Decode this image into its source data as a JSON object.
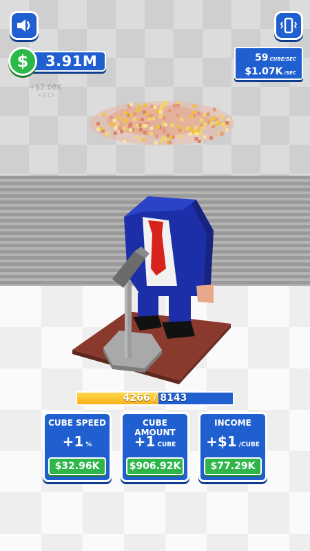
{
  "hud": {
    "money": "3.91M",
    "floating_gain": "+$2.08K",
    "floating_gain_small": "+$13"
  },
  "rates": {
    "cubes_value": "59",
    "cubes_unit": "CUBE/SEC",
    "money_value": "$1.07K",
    "money_unit": "/SEC"
  },
  "progress": {
    "current": 4266,
    "total": 8143,
    "label": "4266 / 8143",
    "fraction": 0.524
  },
  "upgrades": [
    {
      "title": "CUBE SPEED",
      "amount": "+1",
      "unit": "%",
      "price": "$32.96K"
    },
    {
      "title": "CUBE AMOUNT",
      "amount": "+1",
      "unit": "CUBE",
      "price": "$906.92K"
    },
    {
      "title": "INCOME",
      "amount": "+$1",
      "unit": "/CUBE",
      "price": "$77.29K"
    }
  ],
  "icons": {
    "sound": "speaker-icon",
    "vibration": "vibration-icon",
    "currency": "dollar-icon"
  },
  "colors": {
    "panel_blue": "#1f5fd0",
    "buy_green": "#2fb64a",
    "progress_yellow": "#f7b21a",
    "suit_blue": "#1c2fa8",
    "tie_red": "#d8231c"
  }
}
